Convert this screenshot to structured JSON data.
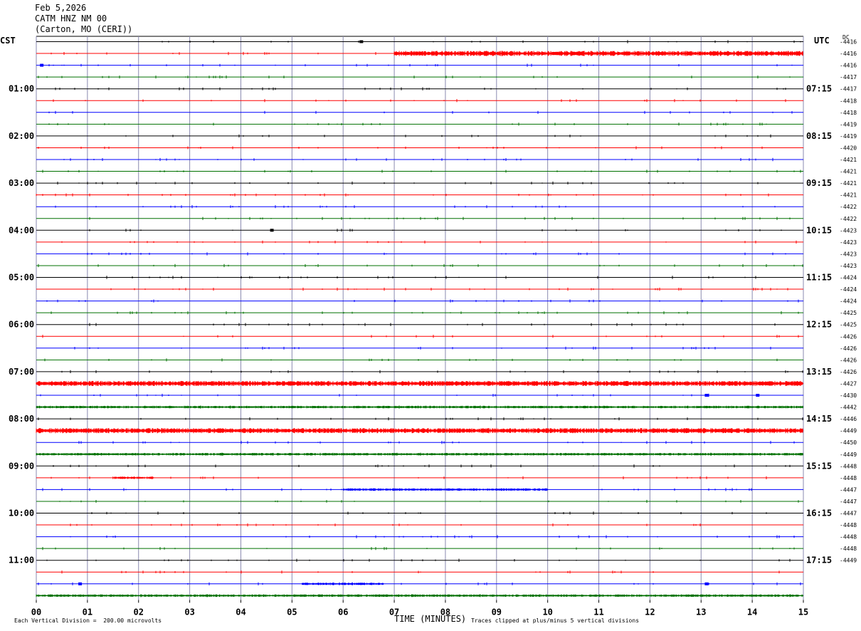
{
  "header": {
    "date": "Feb 5,2026",
    "station": "CATM HNZ NM 00",
    "location": "(Carton, MO (CERI))"
  },
  "left_axis_label": "CST",
  "right_axis_label": "UTC",
  "dc_label": "DC",
  "footer": {
    "scale_note": "Each Vertical Division =  200.00 microvolts",
    "xlabel": "TIME (MINUTES)",
    "clip_note": "Traces clipped at plus/minus 5 vertical divisions"
  },
  "chart_data": {
    "type": "line",
    "title": "Feb 5,2026",
    "xlabel": "TIME (MINUTES)",
    "xlim": [
      0,
      15
    ],
    "x_ticks": [
      "00",
      "01",
      "02",
      "03",
      "04",
      "05",
      "06",
      "07",
      "08",
      "09",
      "10",
      "11",
      "12",
      "13",
      "14",
      "15"
    ],
    "trace_count": 48,
    "trace_colors": [
      "#000000",
      "#ff0000",
      "#0000ff",
      "#007000"
    ],
    "left_hour_labels": [
      "01:00",
      "02:00",
      "03:00",
      "04:00",
      "05:00",
      "06:00",
      "07:00",
      "08:00",
      "09:00",
      "10:00",
      "11:00"
    ],
    "right_hour_labels": [
      "07:15",
      "08:15",
      "09:15",
      "10:15",
      "11:15",
      "12:15",
      "13:15",
      "14:15",
      "15:15",
      "16:15",
      "17:15"
    ],
    "dc_offsets": [
      "-4416",
      "-4416",
      "-4416",
      "-4417",
      "-4417",
      "-4418",
      "-4418",
      "-4419",
      "-4419",
      "-4420",
      "-4421",
      "-4421",
      "-4421",
      "-4421",
      "-4422",
      "-4422",
      "-4423",
      "-4423",
      "-4423",
      "-4423",
      "-4424",
      "-4424",
      "-4424",
      "-4425",
      "-4425",
      "-4426",
      "-4426",
      "-4426",
      "-4426",
      "-4427",
      "-4430",
      "-4442",
      "-4446",
      "-4449",
      "-4450",
      "-4449",
      "-4448",
      "-4448",
      "-4447",
      "-4447",
      "-4447",
      "-4448",
      "-4448",
      "-4448",
      "-4449"
    ],
    "noisy_segments": [
      {
        "trace": 1,
        "from": 7.0,
        "to": 15.0,
        "level": 2
      },
      {
        "trace": 29,
        "from": 0.0,
        "to": 15.0,
        "level": 2
      },
      {
        "trace": 31,
        "from": 0.0,
        "to": 15.0,
        "level": 1
      },
      {
        "trace": 33,
        "from": 0.0,
        "to": 15.0,
        "level": 2
      },
      {
        "trace": 35,
        "from": 0.0,
        "to": 15.0,
        "level": 1
      },
      {
        "trace": 37,
        "from": 1.5,
        "to": 2.3,
        "level": 1
      },
      {
        "trace": 38,
        "from": 6.0,
        "to": 10.0,
        "level": 1
      },
      {
        "trace": 46,
        "from": 5.2,
        "to": 6.8,
        "level": 1
      },
      {
        "trace": 47,
        "from": 0.0,
        "to": 15.0,
        "level": 1
      }
    ],
    "spike_events": [
      {
        "trace": 0,
        "minute": 6.35
      },
      {
        "trace": 2,
        "minute": 0.1
      },
      {
        "trace": 16,
        "minute": 4.6
      },
      {
        "trace": 30,
        "minute": 13.1
      },
      {
        "trace": 30,
        "minute": 14.1
      },
      {
        "trace": 46,
        "minute": 0.85
      },
      {
        "trace": 46,
        "minute": 13.1
      }
    ]
  }
}
